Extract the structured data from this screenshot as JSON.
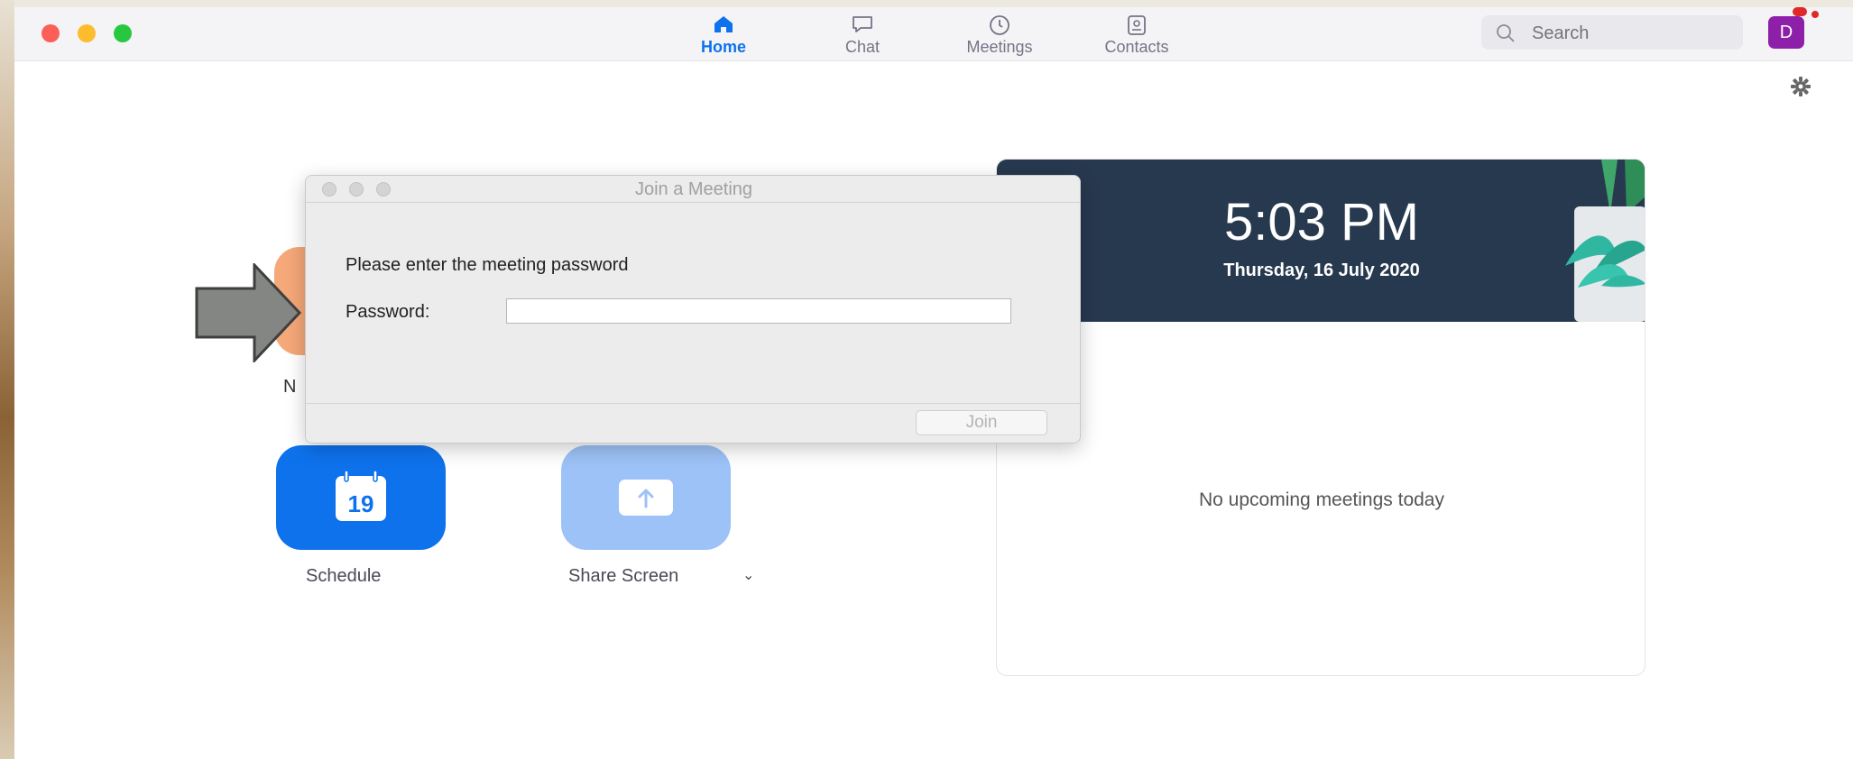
{
  "window": {
    "traffic_lights": [
      "close",
      "minimize",
      "zoom"
    ]
  },
  "nav": {
    "tabs": [
      {
        "label": "Home",
        "icon": "home-icon",
        "active": true
      },
      {
        "label": "Chat",
        "icon": "chat-bubble-icon",
        "active": false
      },
      {
        "label": "Meetings",
        "icon": "clock-icon",
        "active": false
      },
      {
        "label": "Contacts",
        "icon": "contact-card-icon",
        "active": false
      }
    ],
    "accent_color": "#0e72ed"
  },
  "search": {
    "placeholder": "Search"
  },
  "user": {
    "avatar_initial": "D",
    "avatar_color": "#8e1fa8"
  },
  "home": {
    "new_meeting_label_partial": "N",
    "schedule": {
      "label": "Schedule",
      "calendar_day": "19"
    },
    "share_screen": {
      "label": "Share Screen",
      "caret": "⌄"
    }
  },
  "card": {
    "time": "5:03 PM",
    "date": "Thursday, 16 July 2020",
    "empty_message": "No upcoming meetings today"
  },
  "dialog": {
    "title": "Join a Meeting",
    "prompt": "Please enter the meeting password",
    "password_label": "Password:",
    "password_value": "",
    "join_label": "Join",
    "join_enabled": false
  }
}
